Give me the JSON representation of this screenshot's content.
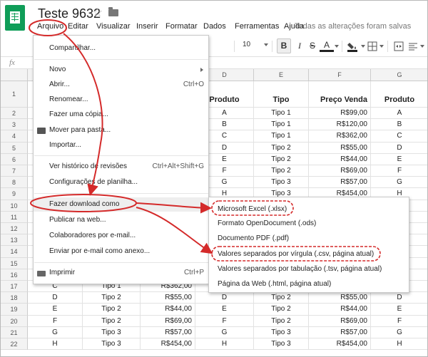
{
  "app": {
    "title": "Teste 9632",
    "save_status": "Todas as alterações foram salvas"
  },
  "menubar": [
    "Arquivo",
    "Editar",
    "Visualizar",
    "Inserir",
    "Formatar",
    "Dados",
    "Ferramentas",
    "Ajuda"
  ],
  "toolbar": {
    "font_size": "10",
    "bold": "B",
    "italic": "I",
    "strike": "S",
    "text_color": "A"
  },
  "formula_bar": {
    "fx": "fx"
  },
  "columns": [
    "D",
    "E",
    "F",
    "G"
  ],
  "rows": [
    {
      "n": "1",
      "cells": [
        "Produto",
        "Tipo",
        "Preço Venda",
        "Produto"
      ]
    },
    {
      "n": "2",
      "cells": [
        "A",
        "Tipo 1",
        "R$99,00",
        "A"
      ]
    },
    {
      "n": "3",
      "cells": [
        "B",
        "Tipo 1",
        "R$120,00",
        "B"
      ]
    },
    {
      "n": "4",
      "cells": [
        "C",
        "Tipo 1",
        "R$362,00",
        "C"
      ]
    },
    {
      "n": "5",
      "cells": [
        "D",
        "Tipo 2",
        "R$55,00",
        "D"
      ]
    },
    {
      "n": "6",
      "cells": [
        "E",
        "Tipo 2",
        "R$44,00",
        "E"
      ]
    },
    {
      "n": "7",
      "cells": [
        "F",
        "Tipo 2",
        "R$69,00",
        "F"
      ]
    },
    {
      "n": "8",
      "cells": [
        "G",
        "Tipo 3",
        "R$57,00",
        "G"
      ]
    },
    {
      "n": "9",
      "cells": [
        "H",
        "Tipo 3",
        "R$454,00",
        "H"
      ]
    },
    {
      "n": "10",
      "cells": [
        "",
        "",
        "",
        ""
      ]
    },
    {
      "n": "11",
      "cells": [
        "",
        "",
        "",
        ""
      ]
    },
    {
      "n": "12",
      "cells": [
        "",
        "",
        "",
        ""
      ]
    },
    {
      "n": "13",
      "cells": [
        "",
        "",
        "",
        ""
      ]
    },
    {
      "n": "14",
      "cells": [
        "",
        "",
        "",
        ""
      ]
    },
    {
      "n": "15",
      "cells": [
        "",
        "",
        "",
        ""
      ]
    },
    {
      "n": "16",
      "cells": [
        "",
        "",
        "",
        ""
      ]
    },
    {
      "n": "17",
      "left": [
        "C",
        "Tipo 1",
        "R$362,00"
      ],
      "cells": [
        "C",
        "Tipo 1",
        "R$362,00",
        "C"
      ]
    },
    {
      "n": "18",
      "left": [
        "D",
        "Tipo 2",
        "R$55,00"
      ],
      "cells": [
        "D",
        "Tipo 2",
        "R$55,00",
        "D"
      ]
    },
    {
      "n": "19",
      "left": [
        "E",
        "Tipo 2",
        "R$44,00"
      ],
      "cells": [
        "E",
        "Tipo 2",
        "R$44,00",
        "E"
      ]
    },
    {
      "n": "20",
      "left": [
        "F",
        "Tipo 2",
        "R$69,00"
      ],
      "cells": [
        "F",
        "Tipo 2",
        "R$69,00",
        "F"
      ]
    },
    {
      "n": "21",
      "left": [
        "G",
        "Tipo 3",
        "R$57,00"
      ],
      "cells": [
        "G",
        "Tipo 3",
        "R$57,00",
        "G"
      ]
    },
    {
      "n": "22",
      "left": [
        "H",
        "Tipo 3",
        "R$454,00"
      ],
      "cells": [
        "H",
        "Tipo 3",
        "R$454,00",
        "H"
      ]
    }
  ],
  "file_menu": [
    {
      "label": "Compartilhar..."
    },
    {
      "label": "Novo",
      "submenu": true
    },
    {
      "label": "Abrir...",
      "shortcut": "Ctrl+O"
    },
    {
      "label": "Renomear..."
    },
    {
      "label": "Fazer uma cópia..."
    },
    {
      "label": "Mover para pasta...",
      "icon": "folder-icon"
    },
    {
      "label": "Importar..."
    },
    {
      "label": "Ver histórico de revisões",
      "shortcut": "Ctrl+Alt+Shift+G"
    },
    {
      "label": "Configurações de planilha..."
    },
    {
      "label": "Fazer download como",
      "submenu": true,
      "highlighted": true
    },
    {
      "label": "Publicar na web..."
    },
    {
      "label": "Colaboradores por e-mail..."
    },
    {
      "label": "Enviar por e-mail como anexo..."
    },
    {
      "label": "Imprimir",
      "shortcut": "Ctrl+P",
      "icon": "printer-icon"
    }
  ],
  "download_submenu": [
    "Microsoft Excel (.xlsx)",
    "Formato OpenDocument (.ods)",
    "Documento PDF (.pdf)",
    "Valores separados por vírgula (.csv, página atual)",
    "Valores separados por tabulação (.tsv, página atual)",
    "Página da Web (.html, página atual)"
  ],
  "colors": {
    "annotation": "#d42a2a",
    "brand": "#0f9d58",
    "menu_highlight": "#eeeeee"
  }
}
